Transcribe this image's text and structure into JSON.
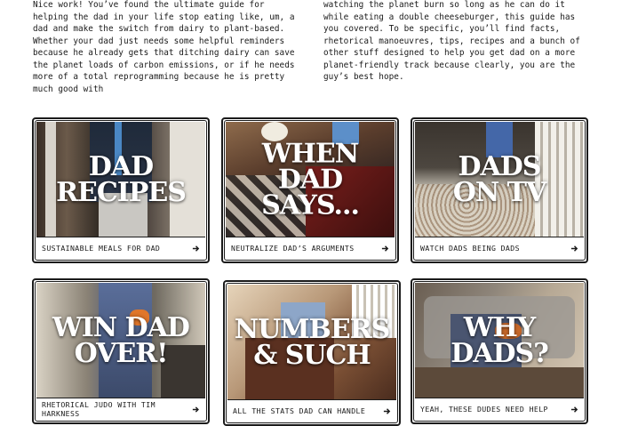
{
  "intro": {
    "left": "Nice work! You’ve found the ultimate guide for helping the dad in your life stop eating like, um, a dad and make the switch from dairy to plant-based. Whether your dad just needs some helpful reminders because he already gets that ditching dairy can save the planet loads of carbon emissions, or if he needs more of a total reprogramming because he is pretty much good with",
    "right": "watching the planet burn so long as he can do it while eating a double cheeseburger, this guide has you covered. To be specific, you’ll find facts, rhetorical manoeuvres, tips, recipes and a bunch of other stuff designed to help you get dad on a more planet-friendly track because clearly, you are the guy’s best hope."
  },
  "cards": [
    {
      "title": "DAD\nRECIPES",
      "caption": "SUSTAINABLE MEALS FOR DAD",
      "icon": "arrow-right-icon"
    },
    {
      "title": "WHEN DAD\nSAYS...",
      "caption": "NEUTRALIZE DAD’S ARGUMENTS",
      "icon": "arrow-right-icon"
    },
    {
      "title": "DADS\nON TV",
      "caption": "WATCH DADS BEING DADS",
      "icon": "arrow-right-icon"
    },
    {
      "title": "WIN DAD\nOVER!",
      "caption": "RHETORICAL JUDO WITH TIM HARKNESS",
      "icon": "arrow-right-icon"
    },
    {
      "title": "NUMBERS\n& SUCH",
      "caption": "ALL THE STATS DAD CAN HANDLE",
      "icon": "arrow-right-icon"
    },
    {
      "title": "WHY\nDADS?",
      "caption": "YEAH, THESE DUDES NEED HELP",
      "icon": "arrow-right-icon"
    }
  ],
  "colors": {
    "border": "#1b1b1b",
    "text": "#1a1a1a",
    "title": "#ffffff"
  }
}
